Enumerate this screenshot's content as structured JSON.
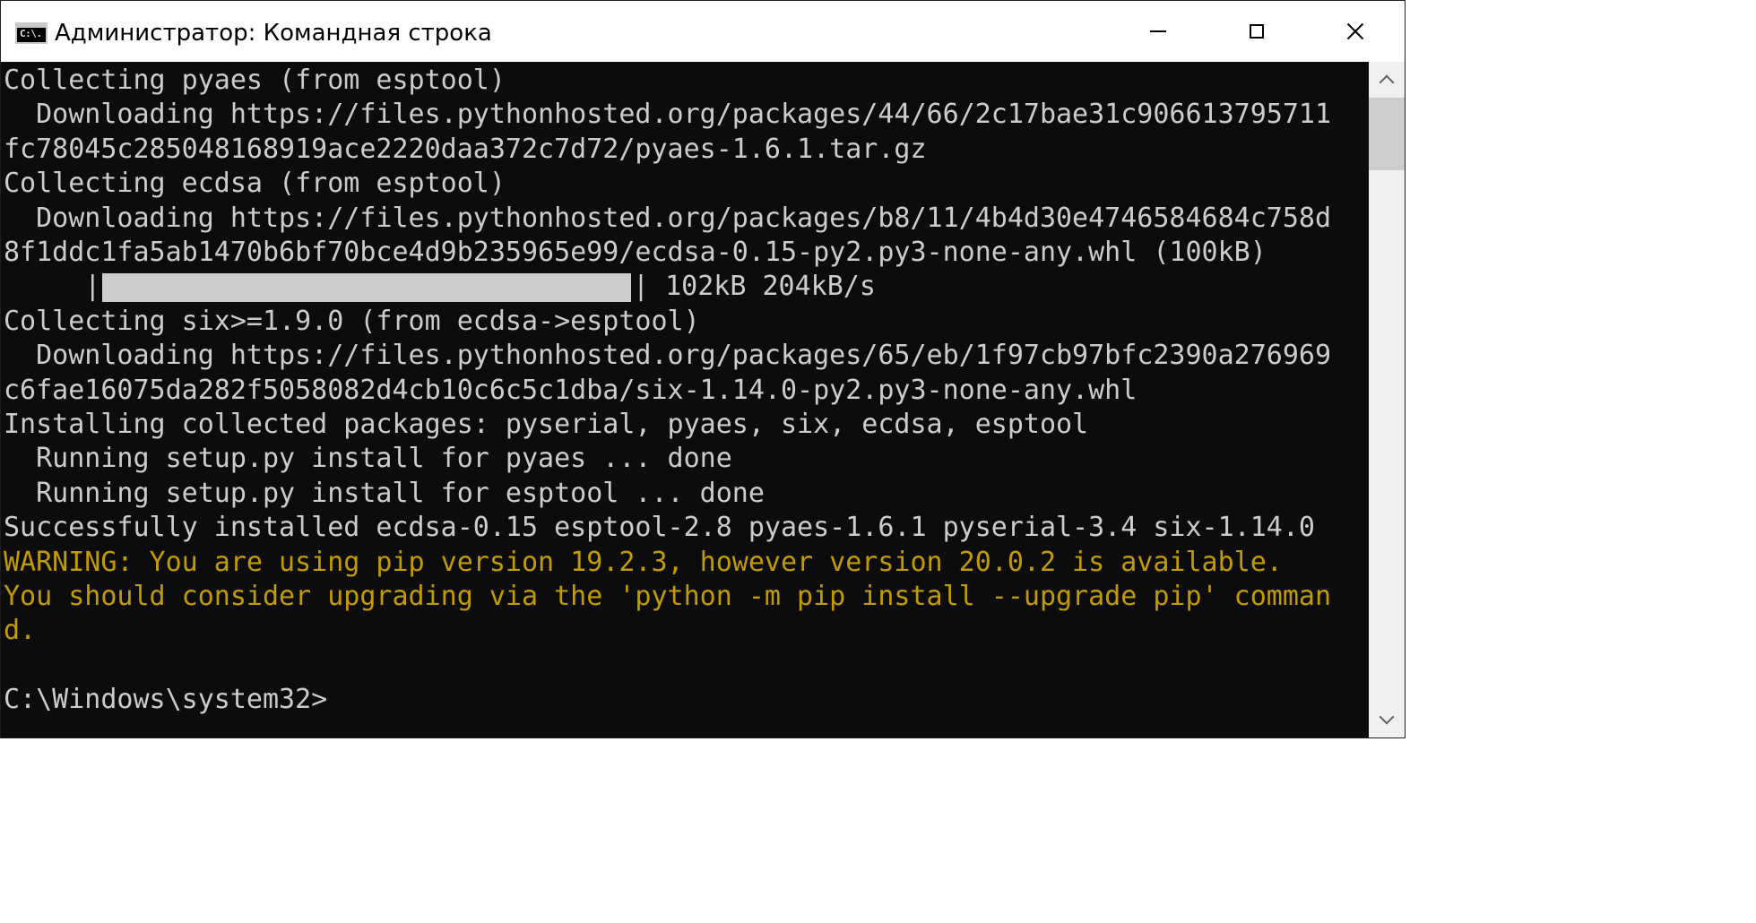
{
  "window": {
    "title": "Администратор: Командная строка",
    "icon": "cmd-icon",
    "icon_text": "C:\\."
  },
  "colors": {
    "console_bg": "#0c0c0c",
    "text": "#cccccc",
    "warning": "#c19c00",
    "titlebar_bg": "#ffffff",
    "scrollbar_bg": "#f0f0f0",
    "scrollbar_thumb": "#cdcdcd"
  },
  "console": {
    "lines": [
      {
        "text": "Collecting pyaes (from esptool)",
        "style": "normal"
      },
      {
        "text": "  Downloading https://files.pythonhosted.org/packages/44/66/2c17bae31c906613795711",
        "style": "normal"
      },
      {
        "text": "fc78045c285048168919ace2220daa372c7d72/pyaes-1.6.1.tar.gz",
        "style": "normal"
      },
      {
        "text": "Collecting ecdsa (from esptool)",
        "style": "normal"
      },
      {
        "text": "  Downloading https://files.pythonhosted.org/packages/b8/11/4b4d30e4746584684c758d",
        "style": "normal"
      },
      {
        "text": "8f1ddc1fa5ab1470b6bf70bce4d9b235965e99/ecdsa-0.15-py2.py3-none-any.whl (100kB)",
        "style": "normal"
      },
      {
        "type": "progress"
      },
      {
        "text": "Collecting six>=1.9.0 (from ecdsa->esptool)",
        "style": "normal"
      },
      {
        "text": "  Downloading https://files.pythonhosted.org/packages/65/eb/1f97cb97bfc2390a276969",
        "style": "normal"
      },
      {
        "text": "c6fae16075da282f5058082d4cb10c6c5c1dba/six-1.14.0-py2.py3-none-any.whl",
        "style": "normal"
      },
      {
        "text": "Installing collected packages: pyserial, pyaes, six, ecdsa, esptool",
        "style": "normal"
      },
      {
        "text": "  Running setup.py install for pyaes ... done",
        "style": "normal"
      },
      {
        "text": "  Running setup.py install for esptool ... done",
        "style": "normal"
      },
      {
        "text": "Successfully installed ecdsa-0.15 esptool-2.8 pyaes-1.6.1 pyserial-3.4 six-1.14.0",
        "style": "normal"
      },
      {
        "text": "WARNING: You are using pip version 19.2.3, however version 20.0.2 is available.",
        "style": "warn"
      },
      {
        "text": "You should consider upgrading via the 'python -m pip install --upgrade pip' comman",
        "style": "warn"
      },
      {
        "text": "d.",
        "style": "warn"
      },
      {
        "text": "",
        "style": "normal"
      },
      {
        "text": "C:\\Windows\\system32>",
        "style": "normal"
      }
    ],
    "progress": {
      "lead": "     |",
      "fraction": 1.0,
      "tail": "| 102kB 204kB/s"
    }
  },
  "scrollbar": {
    "position_fraction": 0.0,
    "visible_fraction": 0.12
  }
}
